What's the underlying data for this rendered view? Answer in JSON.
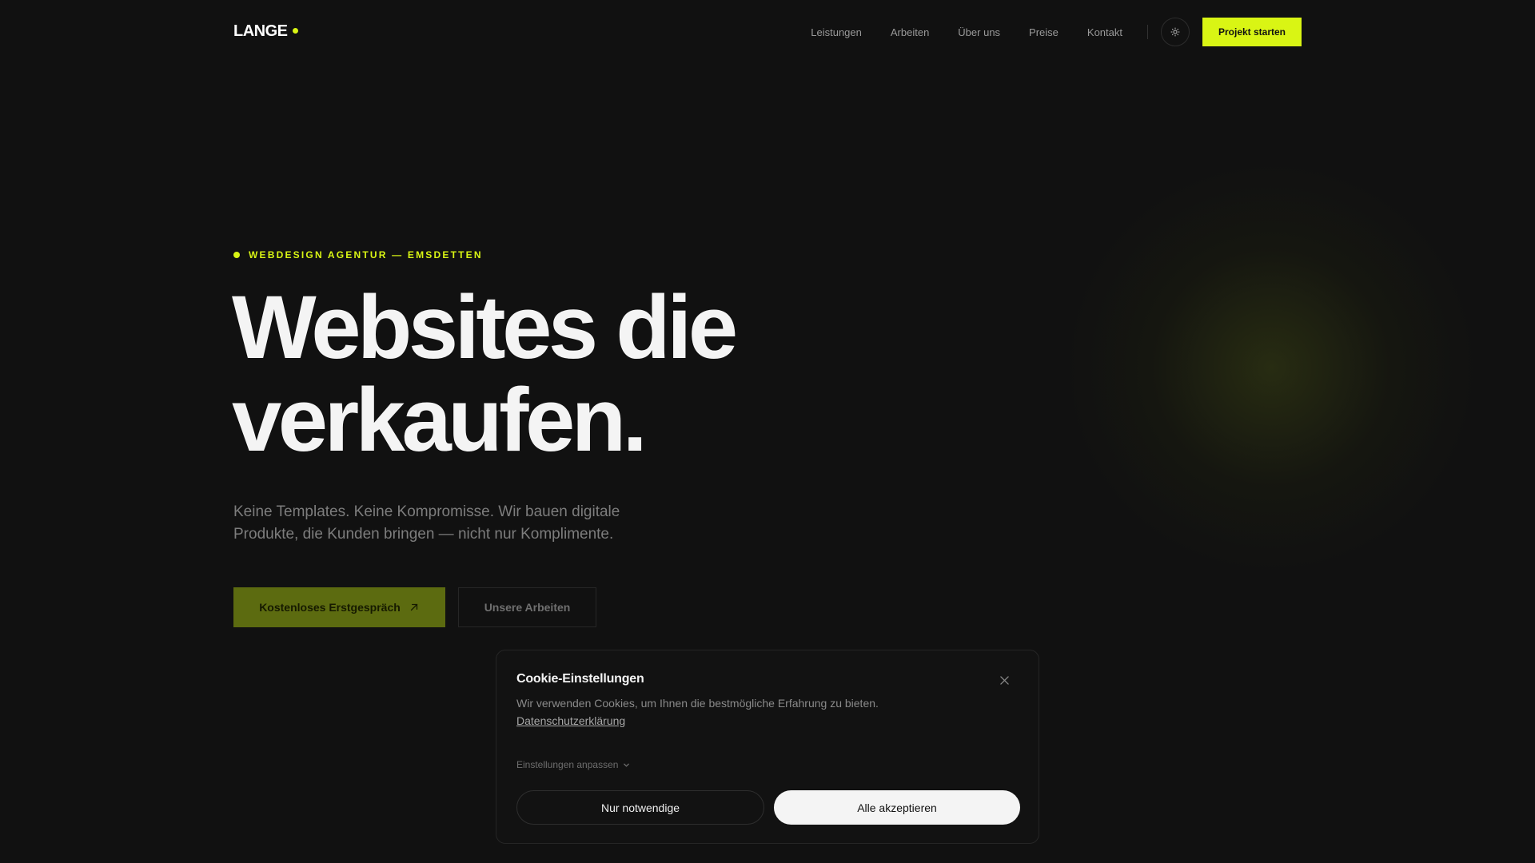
{
  "header": {
    "logo": "LANGE",
    "nav": [
      "Leistungen",
      "Arbeiten",
      "Über uns",
      "Preise",
      "Kontakt"
    ],
    "cta_label": "Projekt starten",
    "theme_icon": "sun-icon"
  },
  "hero": {
    "eyebrow": "WEBDESIGN AGENTUR — EMSDETTEN",
    "title_line1": "Websites die",
    "title_line2": "verkaufen.",
    "subtitle_line1": "Keine Templates. Keine Kompromisse. Wir bauen digitale",
    "subtitle_line2": "Produkte, die Kunden bringen — nicht nur Komplimente.",
    "primary_button": "Kostenloses Erstgespräch",
    "primary_icon": "arrow-up-right-icon",
    "secondary_button": "Unsere Arbeiten"
  },
  "cookie": {
    "title": "Cookie-Einstellungen",
    "text": "Wir verwenden Cookies, um Ihnen die bestmögliche Erfahrung zu bieten.",
    "link": "Datenschutzerklärung",
    "settings_label": "Einstellungen anpassen",
    "necessary_button": "Nur notwendige",
    "accept_button": "Alle akzeptieren"
  },
  "colors": {
    "background": "#111111",
    "accent": "#d9f514",
    "accent_dim": "#5c6b10"
  }
}
